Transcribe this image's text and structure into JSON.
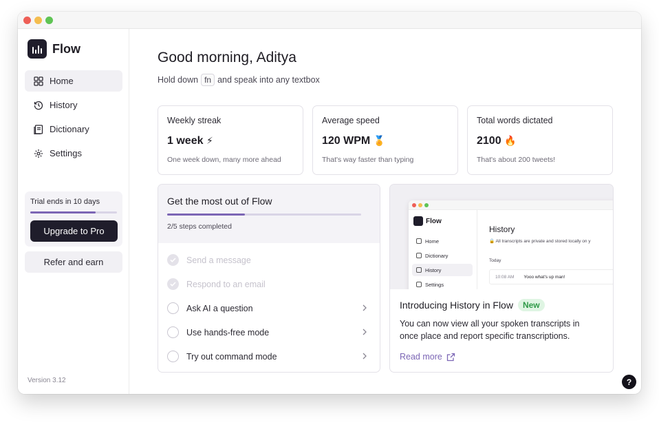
{
  "app": {
    "name": "Flow",
    "version": "Version 3.12"
  },
  "sidebar": {
    "items": [
      {
        "label": "Home",
        "icon": "grid-icon",
        "active": true
      },
      {
        "label": "History",
        "icon": "history-icon",
        "active": false
      },
      {
        "label": "Dictionary",
        "icon": "book-icon",
        "active": false
      },
      {
        "label": "Settings",
        "icon": "gear-icon",
        "active": false
      }
    ],
    "trial": {
      "text": "Trial ends in 10 days",
      "progress": 0.75
    },
    "upgrade_label": "Upgrade to Pro",
    "refer_label": "Refer and earn"
  },
  "main": {
    "greeting": "Good morning, Aditya",
    "hint": {
      "before": "Hold down",
      "key": "fn",
      "after": "and speak into any textbox"
    },
    "stats": [
      {
        "label": "Weekly streak",
        "value": "1 week",
        "emoji": "⚡",
        "desc": "One week down, many more ahead"
      },
      {
        "label": "Average speed",
        "value": "120 WPM",
        "emoji": "🏅",
        "desc": "That's way faster than typing"
      },
      {
        "label": "Total words dictated",
        "value": "2100",
        "emoji": "🔥",
        "desc": "That's about 200 tweets!"
      }
    ],
    "onboarding": {
      "title": "Get the most out of Flow",
      "progress": 0.4,
      "count": "2/5 steps completed",
      "steps": [
        {
          "label": "Send a message",
          "done": true
        },
        {
          "label": "Respond to an email",
          "done": true
        },
        {
          "label": "Ask AI a question",
          "done": false
        },
        {
          "label": "Use hands-free mode",
          "done": false
        },
        {
          "label": "Try out command mode",
          "done": false
        }
      ]
    },
    "announcement": {
      "title": "Introducing History in Flow",
      "badge": "New",
      "body": "You can now view all your spoken transcripts in once place and report specific transcriptions.",
      "link": "Read more",
      "preview": {
        "logo": "Flow",
        "nav": [
          "Home",
          "Dictionary",
          "History",
          "Settings"
        ],
        "title": "History",
        "subtitle": "All transcripts are private and stored locally on y",
        "today": "Today",
        "row_time": "10:08 AM",
        "row_text": "Yooo what's up man!"
      }
    },
    "help_label": "?"
  },
  "colors": {
    "accent": "#7c66b5",
    "dark": "#1f1d2b",
    "badge_bg": "#dff5e3",
    "badge_fg": "#2f9a48"
  }
}
